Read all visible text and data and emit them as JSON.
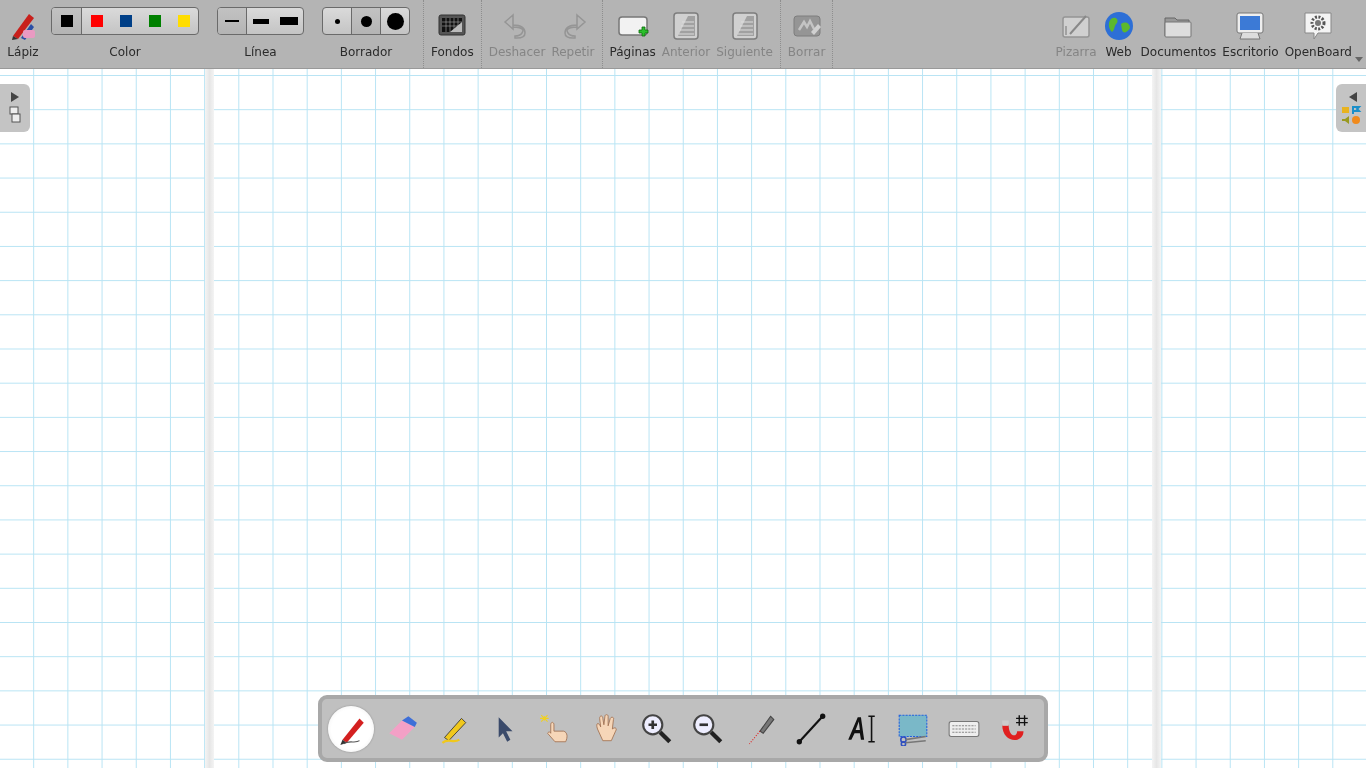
{
  "toolbar": {
    "left": [
      {
        "kind": "pen",
        "label": "Lápiz",
        "disabled": false
      },
      {
        "kind": "color",
        "label": "Color",
        "options": [
          {
            "color": "#000000",
            "selected": true
          },
          {
            "color": "#ff0000",
            "selected": false
          },
          {
            "color": "#003f87",
            "selected": false
          },
          {
            "color": "#008000",
            "selected": false
          },
          {
            "color": "#ffdd00",
            "selected": false
          }
        ]
      },
      {
        "kind": "line",
        "label": "Línea",
        "options": [
          {
            "selected": true
          },
          {
            "selected": false
          },
          {
            "selected": false
          }
        ]
      },
      {
        "kind": "eraser",
        "label": "Borrador",
        "options": [
          {
            "selected": false
          },
          {
            "selected": true
          },
          {
            "selected": false
          }
        ]
      },
      {
        "kind": "separator"
      },
      {
        "kind": "background",
        "label": "Fondos",
        "disabled": false
      },
      {
        "kind": "separator"
      },
      {
        "kind": "undo",
        "label": "Deshacer",
        "disabled": true
      },
      {
        "kind": "redo",
        "label": "Repetir",
        "disabled": true
      },
      {
        "kind": "separator"
      },
      {
        "kind": "addpage",
        "label": "Páginas",
        "disabled": false
      },
      {
        "kind": "prevpage",
        "label": "Anterior",
        "disabled": true
      },
      {
        "kind": "nextpage",
        "label": "Siguiente",
        "disabled": true
      },
      {
        "kind": "separator"
      },
      {
        "kind": "clear",
        "label": "Borrar",
        "disabled": true
      },
      {
        "kind": "separator"
      }
    ],
    "right": [
      {
        "kind": "board",
        "label": "Pizarra",
        "disabled": true
      },
      {
        "kind": "web",
        "label": "Web",
        "disabled": false
      },
      {
        "kind": "documents",
        "label": "Documentos",
        "disabled": false
      },
      {
        "kind": "desktop",
        "label": "Escritorio",
        "disabled": false
      },
      {
        "kind": "app",
        "label": "OpenBoard",
        "disabled": false,
        "menu": true
      }
    ]
  },
  "palette": {
    "tools": [
      {
        "kind": "pen",
        "selected": true
      },
      {
        "kind": "eraser",
        "selected": false
      },
      {
        "kind": "marker",
        "selected": false
      },
      {
        "kind": "selector",
        "selected": false
      },
      {
        "kind": "interact",
        "selected": false
      },
      {
        "kind": "hand",
        "selected": false
      },
      {
        "kind": "zoomin",
        "selected": false
      },
      {
        "kind": "zoomout",
        "selected": false
      },
      {
        "kind": "laser",
        "selected": false
      },
      {
        "kind": "line",
        "selected": false
      },
      {
        "kind": "text",
        "selected": false
      },
      {
        "kind": "capture",
        "selected": false
      },
      {
        "kind": "keyboard",
        "selected": false
      },
      {
        "kind": "magnet",
        "selected": false
      }
    ]
  }
}
